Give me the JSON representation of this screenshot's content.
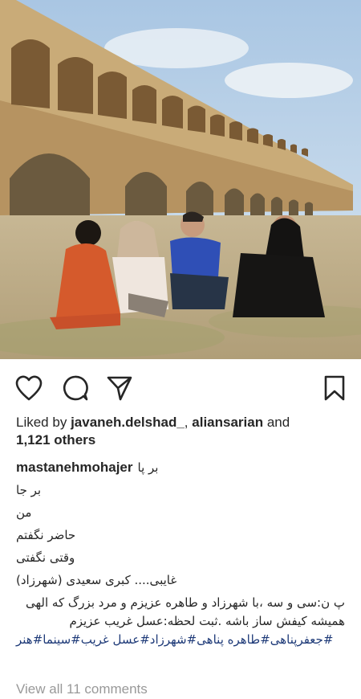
{
  "post": {
    "photo_alt": "",
    "liked_by_prefix": "Liked by",
    "liked_by_users": [
      "javaneh.delshad_",
      "aliansarian"
    ],
    "liked_by_sep": ",",
    "liked_by_and": "and",
    "liked_by_count": "1,121 others",
    "username": "mastanehmohajer",
    "caption_lines": [
      "بر پا",
      "بر جا",
      "من",
      "حاضر نگفتم",
      "وقتی نگفتی",
      "غایبی.... کبری سعیدی (شهرزاد)"
    ],
    "caption_para": "پ ن:سی و سه ،با شهرزاد و طاهره عزیزم و مرد بزرگ که الهی همیشه کیفش ساز باشه .ثبت لحظه:عسل غریب عزیزم",
    "hashtags": "#جعفرپناهی#طاهره پناهی#شهرزاد#عسل غریب#سینما#هنر",
    "view_all": "View all 11 comments"
  },
  "icons": {
    "like": "heart-icon",
    "comment": "comment-bubble-icon",
    "share": "paper-plane-icon",
    "save": "bookmark-icon"
  },
  "colors": {
    "text": "#262626",
    "link": "#1e3a78",
    "muted": "#999999"
  }
}
